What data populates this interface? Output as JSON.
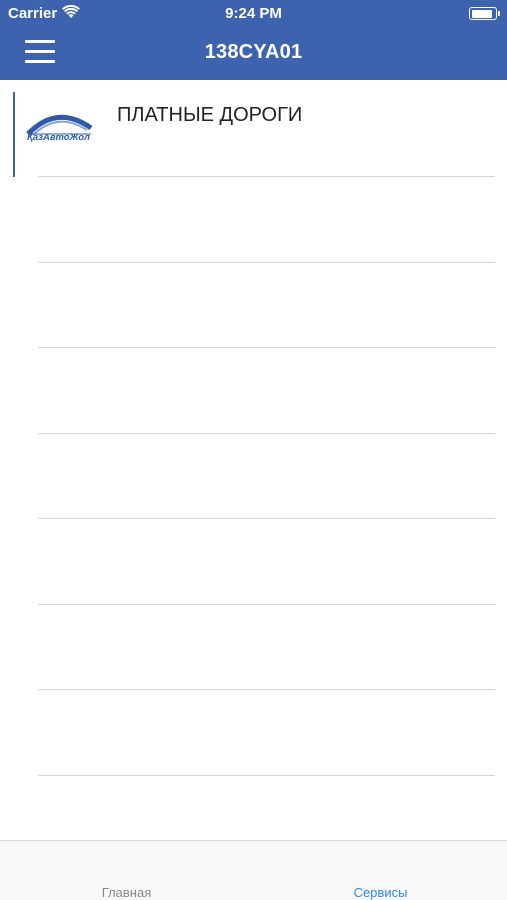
{
  "status_bar": {
    "carrier": "Carrier",
    "time": "9:24 PM"
  },
  "header": {
    "title": "138CYA01"
  },
  "services": [
    {
      "label": "ПЛАТНЫЕ ДОРОГИ",
      "logo_text": "ҚазАвтоЖол"
    }
  ],
  "tabs": [
    {
      "label": "Главная",
      "active": false
    },
    {
      "label": "Сервисы",
      "active": true
    }
  ],
  "colors": {
    "header": "#3e63ae",
    "active_tab": "#2f87ea",
    "inactive_tab": "#8a8a8a"
  }
}
